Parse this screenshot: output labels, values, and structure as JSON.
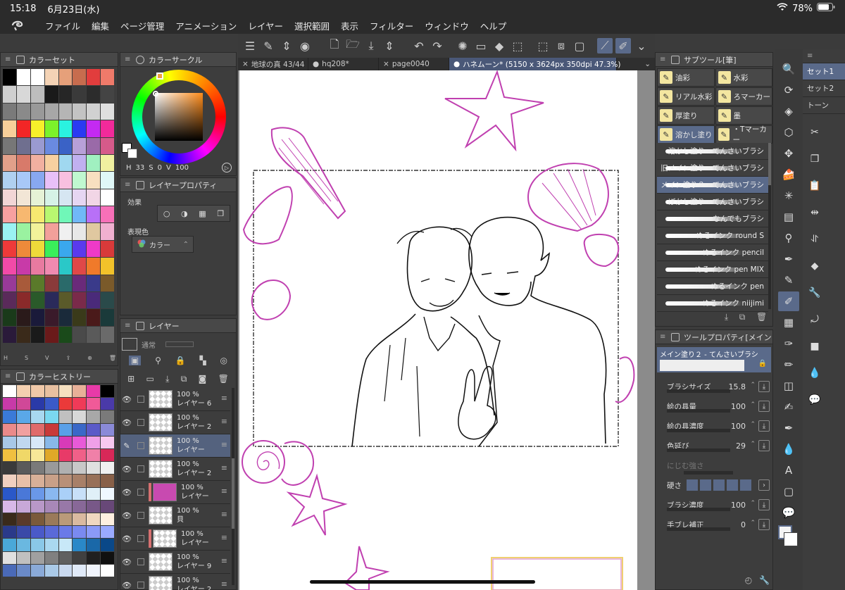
{
  "status": {
    "time": "15:18",
    "date": "6月23日(水)",
    "battery": "78%"
  },
  "menu": [
    "ファイル",
    "編集",
    "ページ管理",
    "アニメーション",
    "レイヤー",
    "選択範囲",
    "表示",
    "フィルター",
    "ウィンドウ",
    "ヘルプ"
  ],
  "tabs": [
    {
      "label": "地球の真 43/44",
      "active": false
    },
    {
      "label": "hq208*",
      "active": false
    },
    {
      "label": "page0040",
      "active": false
    },
    {
      "label": "ハネムーン* (5150 x 3624px 350dpi 47.3%)",
      "active": true
    }
  ],
  "colorset": {
    "title": "カラーセット",
    "swatches": [
      "#000000",
      "#ffffff",
      "#ffffff",
      "#f4d3b5",
      "#e6a07a",
      "#c76c4e",
      "#e23d3d",
      "#ef7a6a",
      "#cfcfcf",
      "#d8d8d8",
      "#bdbdbd",
      "#1a1a1a",
      "#262626",
      "#3a3a3a",
      "#2c2c2c",
      "#444444",
      "#7a7a7a",
      "#8a8a8a",
      "#999999",
      "#a7a7a7",
      "#b5b5b5",
      "#c3c3c3",
      "#d1d1d1",
      "#dfdfdf",
      "#f7cf9a",
      "#f22626",
      "#f7ef2a",
      "#7cf22a",
      "#2af2e0",
      "#2a3af2",
      "#c42af2",
      "#f22a9a",
      "#777777",
      "#6f6f8f",
      "#9a9ad0",
      "#6a8ae0",
      "#3a62c6",
      "#b8a0d8",
      "#9a6aa8",
      "#d65a8a",
      "#e2a08a",
      "#d87a6a",
      "#f2b0a0",
      "#f7d0a0",
      "#a0d8f0",
      "#c0b0f0",
      "#a0f0c0",
      "#f0f0a0",
      "#b0d0f0",
      "#a8c8f8",
      "#88a8f0",
      "#e8c0f8",
      "#f8c0e0",
      "#c0f8d0",
      "#f8e0c0",
      "#e0f8f8",
      "#f2d6d6",
      "#f2e6d6",
      "#e6f2d6",
      "#d6f2e6",
      "#d6e6f2",
      "#e6d6f2",
      "#f2d6e6",
      "#ffffff",
      "#f7a0a0",
      "#f7b870",
      "#f7e870",
      "#b8f770",
      "#70f7b8",
      "#70b8f7",
      "#b870f7",
      "#f770b8",
      "#9af2f2",
      "#9af2a0",
      "#f2f29a",
      "#f2a09a",
      "#f0f0f0",
      "#e8e8e8",
      "#e0c8a0",
      "#f0b0d0",
      "#ee3a3a",
      "#ee8a3a",
      "#eeda3a",
      "#3aee5a",
      "#3aa8ee",
      "#5a3aee",
      "#ee3ac8",
      "#d83a3a",
      "#f24aa8",
      "#c83aa8",
      "#e87aa0",
      "#f08ab0",
      "#2ac8c8",
      "#e04848",
      "#f07a2a",
      "#f2c22a",
      "#983a98",
      "#a85a3a",
      "#5a7a2a",
      "#8a3a3a",
      "#2a6a6a",
      "#6a2a7a",
      "#3a3a8a",
      "#7a5a2a",
      "#5a2a5a",
      "#8a2a2a",
      "#2a5a2a",
      "#2a2a5a",
      "#5a5a2a",
      "#7a2a4a",
      "#4a2a7a",
      "#2a4a4a",
      "#1a3a1a",
      "#2a1a1a",
      "#1a1a3a",
      "#3a1a2a",
      "#1a2a3a",
      "#3a3a1a",
      "#4a1a1a",
      "#1a3a3a",
      "#2a1a3a",
      "#3a2a1a",
      "#1a1a1a",
      "#6a1a1a",
      "#1a4a1a",
      "#4a4a4a",
      "#5a5a5a",
      "#6a6a6a",
      "#e2c0b0",
      "#f0c8a8",
      "#f8d8b8",
      "#e8b898",
      "#d8a888",
      "#c89878",
      "#b88868",
      "#a87858"
    ]
  },
  "colorhistory": {
    "title": "カラーヒストリー",
    "swatches": [
      "#ffffff",
      "#f4d0b0",
      "#f0c8a8",
      "#e8c0a0",
      "#f6e0c0",
      "#e8b098",
      "#e83aa8",
      "#000000",
      "#c83aa8",
      "#d04898",
      "#2a3aa8",
      "#3a5ac8",
      "#ea3a3a",
      "#f03a58",
      "#f05a98",
      "#4a3aa8",
      "#3a7ad8",
      "#5aa8e8",
      "#a8d8f0",
      "#7ad8f0",
      "#c0c0c0",
      "#d8d8d8",
      "#a8a8a8",
      "#7a7a7a",
      "#ea8a8a",
      "#f0a0a0",
      "#e06a6a",
      "#c83a3a",
      "#5aa0e8",
      "#3a68c8",
      "#5a5ac8",
      "#8a8ad8",
      "#a8c8e8",
      "#c0d8f0",
      "#d8e8f8",
      "#88b8e8",
      "#d83ab8",
      "#e85ad8",
      "#f0a0e8",
      "#f8c8f0",
      "#f0c040",
      "#f0d868",
      "#f8e898",
      "#e0a828",
      "#e83a68",
      "#f06088",
      "#f080a8",
      "#d82858",
      "#3a3a3a",
      "#5a5a5a",
      "#7a7a7a",
      "#9a9a9a",
      "#b0b0b0",
      "#c8c8c8",
      "#e0e0e0",
      "#f0f0f0",
      "#f0d0c0",
      "#e8c0a8",
      "#d8b098",
      "#c8a088",
      "#b89078",
      "#a88068",
      "#987058",
      "#886048",
      "#2a58c8",
      "#4a78d8",
      "#6a98e8",
      "#8ab8f0",
      "#aad0f8",
      "#c8e0f8",
      "#e0f0f8",
      "#f0f8ff",
      "#d8b8e8",
      "#c8a8d8",
      "#b898c8",
      "#a888b8",
      "#9878a8",
      "#886898",
      "#785888",
      "#684878",
      "#3a2a1a",
      "#5a3a2a",
      "#7a5a3a",
      "#9a7a5a",
      "#ba9a7a",
      "#dabaa0",
      "#f0d8c0",
      "#fff0e0",
      "#2a3a8a",
      "#3a4aa8",
      "#4a5ac8",
      "#5a6ad8",
      "#6a7ae8",
      "#7a8af0",
      "#8a9af8",
      "#9aaaff",
      "#4aa8d8",
      "#6ab8e0",
      "#8ac8e8",
      "#aad8f0",
      "#c8e8f8",
      "#2a88c8",
      "#1a68a8",
      "#0a4888",
      "#e0e0e0",
      "#c0c0c0",
      "#a0a0a0",
      "#808080",
      "#606060",
      "#404040",
      "#202020",
      "#101010",
      "#4a6ab8",
      "#6a8ac8",
      "#8aaad8",
      "#aacae8",
      "#cadaf0",
      "#e0eaf8",
      "#f0f4fc",
      "#ffffff"
    ]
  },
  "colorcircle": {
    "title": "カラーサークル",
    "h": "33",
    "s_label": "S",
    "s": "0",
    "v_label": "V",
    "v": "100",
    "h_label": "H"
  },
  "layerprop": {
    "title": "レイヤープロパティ",
    "effect_label": "効果",
    "express_label": "表現色",
    "express_value": "カラー"
  },
  "layers": {
    "title": "レイヤー",
    "blend": "通常",
    "rows": [
      {
        "opacity": "100 %",
        "name": "レイヤー 6",
        "visible": true,
        "selected": false,
        "color": false,
        "thumb": "check"
      },
      {
        "opacity": "100 %",
        "name": "レイヤー 2",
        "visible": true,
        "selected": false,
        "color": false,
        "thumb": "check"
      },
      {
        "opacity": "100 %",
        "name": "レイヤー",
        "visible": false,
        "selected": true,
        "color": false,
        "thumb": "check"
      },
      {
        "opacity": "100 %",
        "name": "レイヤー 2",
        "visible": true,
        "selected": false,
        "color": false,
        "thumb": "check"
      },
      {
        "opacity": "100 %",
        "name": "レイヤー",
        "visible": true,
        "selected": false,
        "color": true,
        "thumb": "pink"
      },
      {
        "opacity": "100 %",
        "name": "貝",
        "visible": true,
        "selected": false,
        "color": false,
        "thumb": "check"
      },
      {
        "opacity": "100 %",
        "name": "レイヤー",
        "visible": true,
        "selected": false,
        "color": true,
        "thumb": "check"
      },
      {
        "opacity": "100 %",
        "name": "レイヤー 9",
        "visible": true,
        "selected": false,
        "color": false,
        "thumb": "check"
      },
      {
        "opacity": "100 %",
        "name": "レイヤー 2",
        "visible": true,
        "selected": false,
        "color": false,
        "thumb": "check"
      }
    ]
  },
  "subtool": {
    "title": "サブツール[筆]",
    "groups": [
      {
        "label": "油彩",
        "sel": false
      },
      {
        "label": "水彩",
        "sel": false
      },
      {
        "label": "リアル水彩",
        "sel": false
      },
      {
        "label": "ろマーカー",
        "sel": false
      },
      {
        "label": "厚塗り",
        "sel": false
      },
      {
        "label": "墨",
        "sel": false
      },
      {
        "label": "溶かし塗り",
        "sel": true
      },
      {
        "label": "・Tマーカー",
        "sel": false
      }
    ],
    "brushes": [
      {
        "label": "溶かし塗り - てんさいブラシ",
        "sel": false
      },
      {
        "label": "旧メイン塗り - てんさいブラシ",
        "sel": false
      },
      {
        "label": "メイン塗り２ - てんさいブラシ",
        "sel": true
      },
      {
        "label": "ぼかし塗り - てんさいブラシ",
        "sel": false
      },
      {
        "label": "なんでもブラシ",
        "sel": false
      },
      {
        "label": "ぬるインク round S",
        "sel": false
      },
      {
        "label": "ぬるインク pencil",
        "sel": false
      },
      {
        "label": "ぬるインク pen MIX",
        "sel": false
      },
      {
        "label": "ぬるインク pen",
        "sel": false
      },
      {
        "label": "ぬるインク niijimi",
        "sel": false
      }
    ]
  },
  "toolprop": {
    "title": "ツールプロパティ[メイン",
    "brushname": "メイン塗り２ - てんさいブラシ",
    "rows": [
      {
        "label": "ブラシサイズ",
        "value": "15.8"
      },
      {
        "label": "絵の具量",
        "value": "100"
      },
      {
        "label": "絵の具濃度",
        "value": "100"
      },
      {
        "label": "色延び",
        "value": "29"
      },
      {
        "label": "にじむ強さ",
        "value": ""
      },
      {
        "label": "硬さ",
        "value": ""
      },
      {
        "label": "ブラシ濃度",
        "value": "100"
      },
      {
        "label": "手ブレ補正",
        "value": "0"
      }
    ]
  },
  "sets": [
    "セット1",
    "セット2",
    "トーン"
  ],
  "colors": {
    "accent": "#5a6a8a",
    "pink_line": "#c040b0",
    "canvas_bg": "#8b8b8b"
  }
}
